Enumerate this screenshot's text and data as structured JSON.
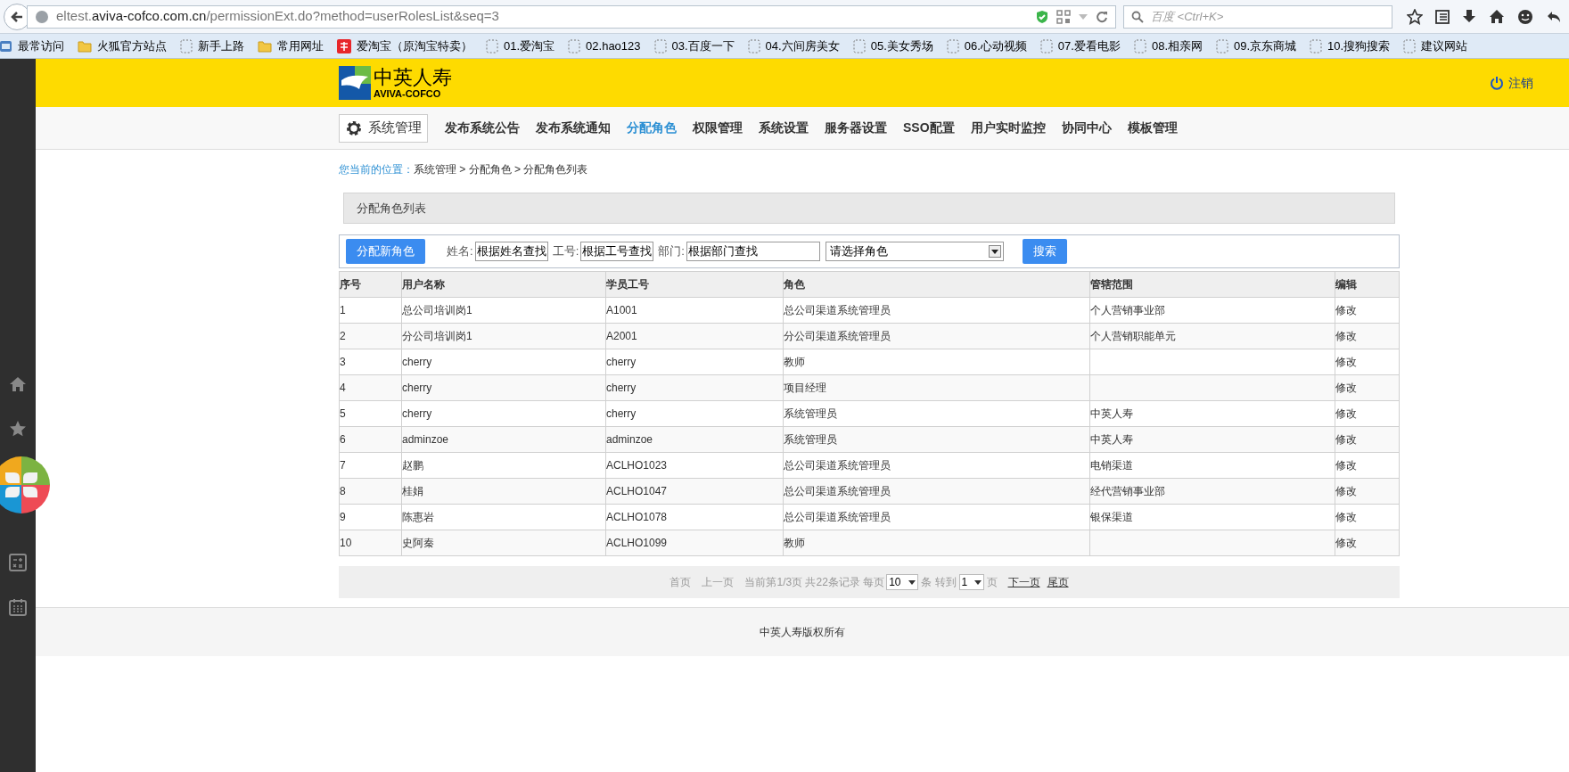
{
  "browser": {
    "url_parts": [
      "eltest.",
      "aviva-cofco.com.cn",
      "/permissionExt.do?method=userRolesList&seq=3"
    ],
    "search_placeholder": "百度 <Ctrl+K>"
  },
  "bookmarks": [
    {
      "label": "最常访问",
      "kind": "recent"
    },
    {
      "label": "火狐官方站点",
      "kind": "folder"
    },
    {
      "label": "新手上路",
      "kind": "blank"
    },
    {
      "label": "常用网址",
      "kind": "folder"
    },
    {
      "label": "爱淘宝（原淘宝特卖）",
      "kind": "taobao"
    },
    {
      "label": "01.爱淘宝",
      "kind": "blank"
    },
    {
      "label": "02.hao123",
      "kind": "blank"
    },
    {
      "label": "03.百度一下",
      "kind": "blank"
    },
    {
      "label": "04.六间房美女",
      "kind": "blank"
    },
    {
      "label": "05.美女秀场",
      "kind": "blank"
    },
    {
      "label": "06.心动视频",
      "kind": "blank"
    },
    {
      "label": "07.爱看电影",
      "kind": "blank"
    },
    {
      "label": "08.相亲网",
      "kind": "blank"
    },
    {
      "label": "09.京东商城",
      "kind": "blank"
    },
    {
      "label": "10.搜狗搜索",
      "kind": "blank"
    },
    {
      "label": "建议网站",
      "kind": "blank"
    }
  ],
  "header": {
    "logo_cn": "中英人寿",
    "logo_en": "AVIVA-COFCO",
    "logout": "注销"
  },
  "nav": {
    "section": "系统管理",
    "items": [
      {
        "label": "发布系统公告",
        "selected": false
      },
      {
        "label": "发布系统通知",
        "selected": false
      },
      {
        "label": "分配角色",
        "selected": true
      },
      {
        "label": "权限管理",
        "selected": false
      },
      {
        "label": "系统设置",
        "selected": false
      },
      {
        "label": "服务器设置",
        "selected": false
      },
      {
        "label": "SSO配置",
        "selected": false
      },
      {
        "label": "用户实时监控",
        "selected": false
      },
      {
        "label": "协同中心",
        "selected": false
      },
      {
        "label": "模板管理",
        "selected": false
      }
    ]
  },
  "breadcrumb": {
    "label": "您当前的位置：",
    "path": "系统管理 > 分配角色 > 分配角色列表"
  },
  "panel_title": "分配角色列表",
  "filters": {
    "add_button": "分配新角色",
    "name_label": "姓名:",
    "name_value": "根据姓名查找",
    "id_label": "工号:",
    "id_value": "根据工号查找",
    "dept_label": "部门:",
    "dept_value": "根据部门查找",
    "role_select": "请选择角色",
    "search_button": "搜索"
  },
  "table": {
    "columns": [
      "序号",
      "用户名称",
      "学员工号",
      "角色",
      "管辖范围",
      "编辑"
    ],
    "rows": [
      [
        "1",
        "总公司培训岗1",
        "A1001",
        "总公司渠道系统管理员",
        "个人营销事业部",
        "修改"
      ],
      [
        "2",
        "分公司培训岗1",
        "A2001",
        "分公司渠道系统管理员",
        "个人营销职能单元",
        "修改"
      ],
      [
        "3",
        "cherry",
        "cherry",
        "教师",
        "",
        "修改"
      ],
      [
        "4",
        "cherry",
        "cherry",
        "项目经理",
        "",
        "修改"
      ],
      [
        "5",
        "cherry",
        "cherry",
        "系统管理员",
        "中英人寿",
        "修改"
      ],
      [
        "6",
        "adminzoe",
        "adminzoe",
        "系统管理员",
        "中英人寿",
        "修改"
      ],
      [
        "7",
        "赵鹏",
        "ACLHO1023",
        "总公司渠道系统管理员",
        "电销渠道",
        "修改"
      ],
      [
        "8",
        "桂娟",
        "ACLHO1047",
        "总公司渠道系统管理员",
        "经代营销事业部",
        "修改"
      ],
      [
        "9",
        "陈惠岩",
        "ACLHO1078",
        "总公司渠道系统管理员",
        "银保渠道",
        "修改"
      ],
      [
        "10",
        "史阿秦",
        "ACLHO1099",
        "教师",
        "",
        "修改"
      ]
    ]
  },
  "pagination": {
    "first": "首页",
    "prev": "上一页",
    "info": "当前第1/3页 共22条记录 每页",
    "page_size": "10",
    "per_unit": "条 转到",
    "page": "1",
    "page_unit": "页",
    "next": "下一页",
    "last": "尾页"
  },
  "footer": "中英人寿版权所有"
}
